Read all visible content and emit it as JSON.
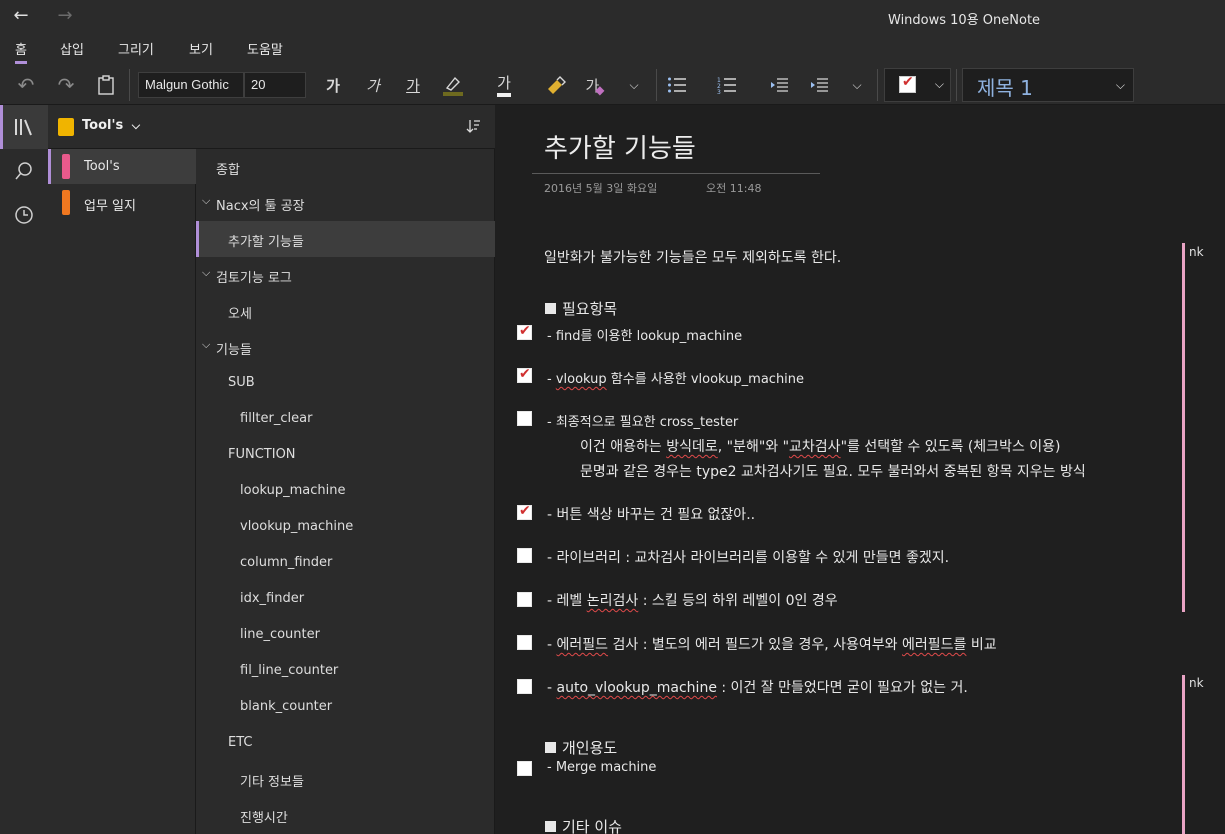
{
  "window": {
    "title": "Windows 10용 OneNote"
  },
  "menu": {
    "items": [
      "홈",
      "삽입",
      "그리기",
      "보기",
      "도움말"
    ],
    "active": "홈"
  },
  "ribbon": {
    "font_name": "Malgun Gothic",
    "font_size": "20",
    "bold": "가",
    "italic": "가",
    "underline": "가",
    "font_color": "가",
    "clear_format": "가",
    "tag_checked": true,
    "style": "제목 1"
  },
  "notebook": {
    "name": "Tool's"
  },
  "sections": [
    {
      "label": "Tool's",
      "color": "#e85a8c",
      "active": true
    },
    {
      "label": "업무 일지",
      "color": "#f07820",
      "active": false
    }
  ],
  "pages": [
    {
      "label": "종합",
      "level": 0
    },
    {
      "label": "Nacx의 툴 공장",
      "level": 0,
      "caret": "❯"
    },
    {
      "label": "추가할 기능들",
      "level": 1,
      "active": true
    },
    {
      "label": "검토기능 로그",
      "level": 0,
      "caret": "❯"
    },
    {
      "label": "오세",
      "level": 1
    },
    {
      "label": "기능들",
      "level": 0,
      "caret": "❯"
    },
    {
      "label": "SUB",
      "level": 1
    },
    {
      "label": "fillter_clear",
      "level": 2
    },
    {
      "label": "FUNCTION",
      "level": 1
    },
    {
      "label": "lookup_machine",
      "level": 2
    },
    {
      "label": "vlookup_machine",
      "level": 2
    },
    {
      "label": "column_finder",
      "level": 2
    },
    {
      "label": "idx_finder",
      "level": 2
    },
    {
      "label": "line_counter",
      "level": 2
    },
    {
      "label": "fil_line_counter",
      "level": 2
    },
    {
      "label": "blank_counter",
      "level": 2
    },
    {
      "label": "ETC",
      "level": 1
    },
    {
      "label": "기타 정보들",
      "level": 2
    },
    {
      "label": "진행시간",
      "level": 2
    }
  ],
  "content": {
    "title": "추가할 기능들",
    "date": "2016년 5월 3일 화요일",
    "time": "오전 11:48",
    "intro": "일반화가 불가능한 기능들은 모두 제외하도록 한다.",
    "heading1": "필요항목",
    "todo1": "- find를 이용한 lookup_machine",
    "todo2_a": "- ",
    "todo2_b": "vlookup",
    "todo2_c": " 함수를 사용한 vlookup_machine",
    "todo3": "- 최종적으로 필요한 cross_tester",
    "todo3_line2_a": "이건 애용하는 ",
    "todo3_line2_b": "방식데로",
    "todo3_line2_c": ", \"분해\"와 \"",
    "todo3_line2_d": "교차검사",
    "todo3_line2_e": "\"를 선택할 수 있도록 (체크박스 이용)",
    "todo3_line3": "문명과 같은 경우는 type2 교차검사기도 필요. 모두 불러와서 중복된 항목 지우는 방식",
    "todo4": "- 버튼 색상 바꾸는 건 필요 없잖아..",
    "todo5": "- 라이브러리 : 교차검사 라이브러리를 이용할 수 있게 만들면 좋겠지.",
    "todo6_a": "- 레벨 ",
    "todo6_b": "논리검사",
    "todo6_c": " : 스킬 등의 하위 레벨이 0인 경우",
    "todo7_a": "- ",
    "todo7_b": "에러필드",
    "todo7_c": " 검사 : 별도의 에러 필드가 있을 경우, 사용여부와 ",
    "todo7_d": "에러필드를",
    "todo7_e": " 비교",
    "todo8_a": "- ",
    "todo8_b": "auto_vlookup_machine",
    "todo8_c": " : 이건 잘 만들었다면 굳이 필요가 없는 거.",
    "heading2": "개인용도",
    "todo9": "- Merge machine",
    "heading3": "기타 이슈",
    "author_initials": "nk"
  }
}
